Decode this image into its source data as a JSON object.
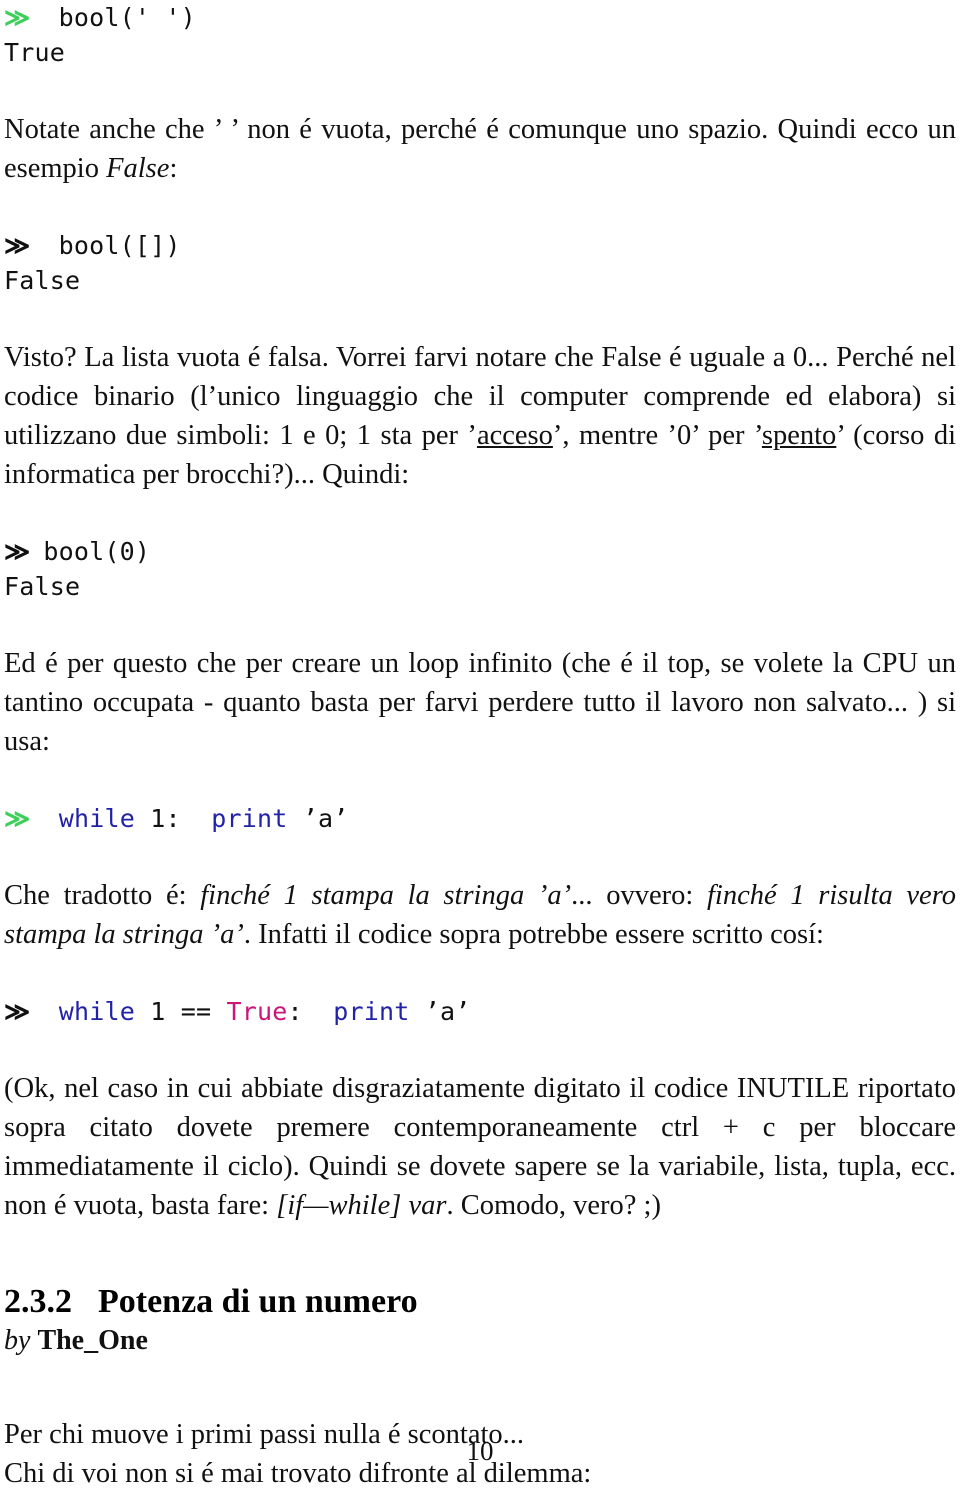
{
  "document": {
    "page_number": "10",
    "language": "it",
    "colors": {
      "prompt_green": "#3ecf5a",
      "keyword_blue": "#2222a8",
      "literal_pink": "#cc1577",
      "text_black": "#111111",
      "background": "#ffffff"
    }
  },
  "blocks": {
    "code_1": {
      "prompt": "≫",
      "body": "  bool(' ')",
      "output": "True"
    },
    "para_1": {
      "t1": "Notate anche che ’ ’ non é vuota, perché é comunque uno spazio. Quindi ecco un esempio ",
      "em1": "False",
      "t2": ":"
    },
    "code_2": {
      "prompt": "≫",
      "body": "  bool([])",
      "output": "False"
    },
    "para_2": {
      "t1": "Visto? La lista vuota é falsa. Vorrei farvi notare che False é uguale a 0... Perché nel codice binario (l’unico linguaggio che il computer comprende ed elabora) si utilizzano due simboli: 1 e 0; 1 sta per ’",
      "u1": "acceso",
      "t2": "’, mentre ’0’ per ’",
      "u2": "spento",
      "t3": "’ (corso di informatica per brocchi?)... Quindi:"
    },
    "code_3": {
      "prompt": "≫",
      "body": " bool(0)",
      "output": "False"
    },
    "para_3": {
      "t1": "Ed é per questo che per creare un loop infinito (che é il top, se volete la CPU un tantino occupata - quanto basta per farvi perdere tutto il lavoro non salvato... ) si usa:"
    },
    "code_4": {
      "prompt": "≫",
      "kw1": "while",
      "mid1": " 1:  ",
      "kw2": "print",
      "mid2": " ’a’"
    },
    "para_4": {
      "t1": "Che tradotto é: ",
      "em1": "finché 1 stampa la stringa ’a’",
      "t2": "... ovvero: ",
      "em2": "finché 1 risulta vero stampa la stringa ’a’",
      "t3": ". Infatti il codice sopra potrebbe essere scritto cosí:"
    },
    "code_5": {
      "prompt": "≫",
      "kw1": "while",
      "mid1": " 1 == ",
      "lit1": "True",
      "mid2": ":  ",
      "kw2": "print",
      "mid3": " ’a’"
    },
    "para_5": {
      "t1": "(Ok, nel caso in cui abbiate disgraziatamente digitato il codice INUTILE riportato sopra citato dovete premere contemporaneamente ctrl + c per bloccare immediatamente il ciclo). Quindi se dovete sapere se la variabile, lista, tupla, ecc. non é vuota, basta fare: ",
      "em1": "[if—while] var",
      "t2": ". Comodo, vero? ;)"
    },
    "section": {
      "number": "2.3.2",
      "title": "Potenza di un numero",
      "by_label": "by",
      "author": "The_One"
    },
    "para_6": {
      "line1": "Per chi muove i primi passi nulla é scontato...",
      "line2": "Chi di voi non si é mai trovato difronte al dilemma:"
    }
  }
}
